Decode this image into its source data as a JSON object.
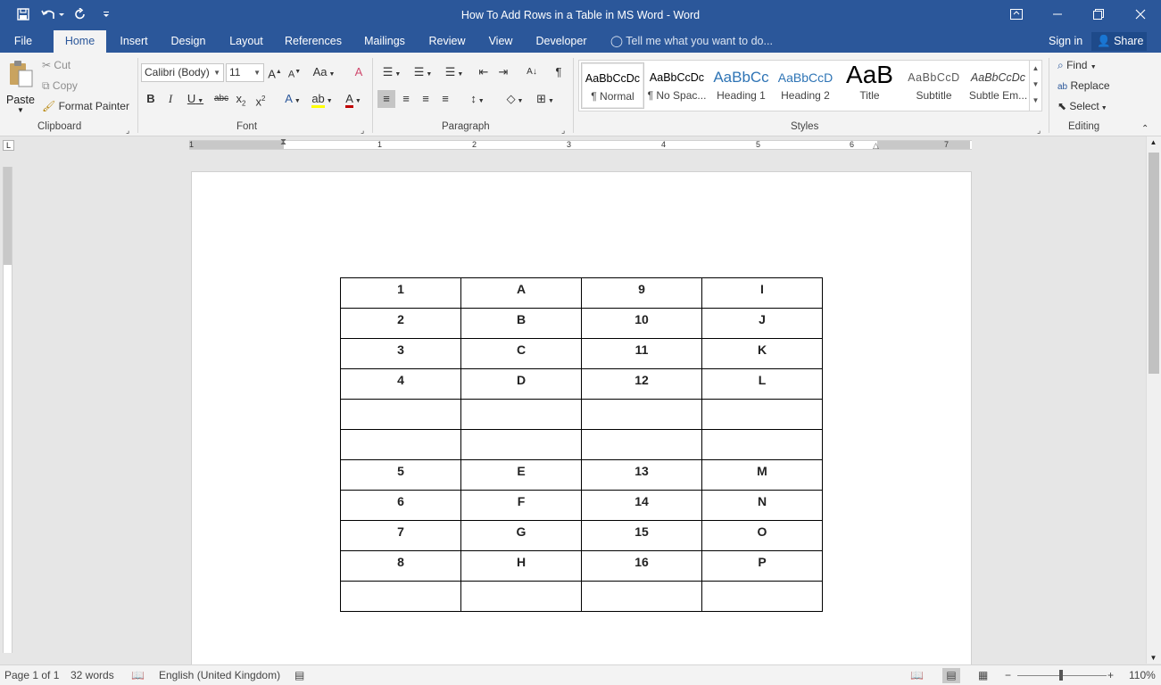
{
  "window": {
    "title": "How To Add Rows in a Table in MS Word - Word"
  },
  "tabs": [
    "File",
    "Home",
    "Insert",
    "Design",
    "Layout",
    "References",
    "Mailings",
    "Review",
    "View",
    "Developer"
  ],
  "tellme": "Tell me what you want to do...",
  "account": {
    "signin": "Sign in",
    "share": "Share"
  },
  "clipboard": {
    "paste": "Paste",
    "cut": "Cut",
    "copy": "Copy",
    "format_painter": "Format Painter",
    "label": "Clipboard"
  },
  "font": {
    "name": "Calibri (Body)",
    "size": "11",
    "label": "Font"
  },
  "paragraph": {
    "label": "Paragraph"
  },
  "styles": {
    "label": "Styles",
    "items": [
      {
        "preview": "AaBbCcDc",
        "name": "¶ Normal"
      },
      {
        "preview": "AaBbCcDc",
        "name": "¶ No Spac..."
      },
      {
        "preview": "AaBbCc",
        "name": "Heading 1"
      },
      {
        "preview": "AaBbCcD",
        "name": "Heading 2"
      },
      {
        "preview": "AaB",
        "name": "Title"
      },
      {
        "preview": "AaBbCcD",
        "name": "Subtitle"
      },
      {
        "preview": "AaBbCcDc",
        "name": "Subtle Em..."
      }
    ]
  },
  "editing": {
    "find": "Find",
    "replace": "Replace",
    "select": "Select",
    "label": "Editing"
  },
  "ruler": {
    "numbers": [
      "1",
      "1",
      "2",
      "3",
      "4",
      "5",
      "6",
      "7"
    ]
  },
  "table": [
    [
      "1",
      "A",
      "9",
      "I"
    ],
    [
      "2",
      "B",
      "10",
      "J"
    ],
    [
      "3",
      "C",
      "11",
      "K"
    ],
    [
      "4",
      "D",
      "12",
      "L"
    ],
    [
      "",
      "",
      "",
      ""
    ],
    [
      "",
      "",
      "",
      ""
    ],
    [
      "5",
      "E",
      "13",
      "M"
    ],
    [
      "6",
      "F",
      "14",
      "N"
    ],
    [
      "7",
      "G",
      "15",
      "O"
    ],
    [
      "8",
      "H",
      "16",
      "P"
    ],
    [
      "",
      "",
      "",
      ""
    ]
  ],
  "status": {
    "page": "Page 1 of 1",
    "words": "32 words",
    "language": "English (United Kingdom)",
    "zoom": "110%"
  },
  "colors": {
    "accent": "#2b579a",
    "highlight": "#ffff00",
    "font_color": "#c00000"
  }
}
